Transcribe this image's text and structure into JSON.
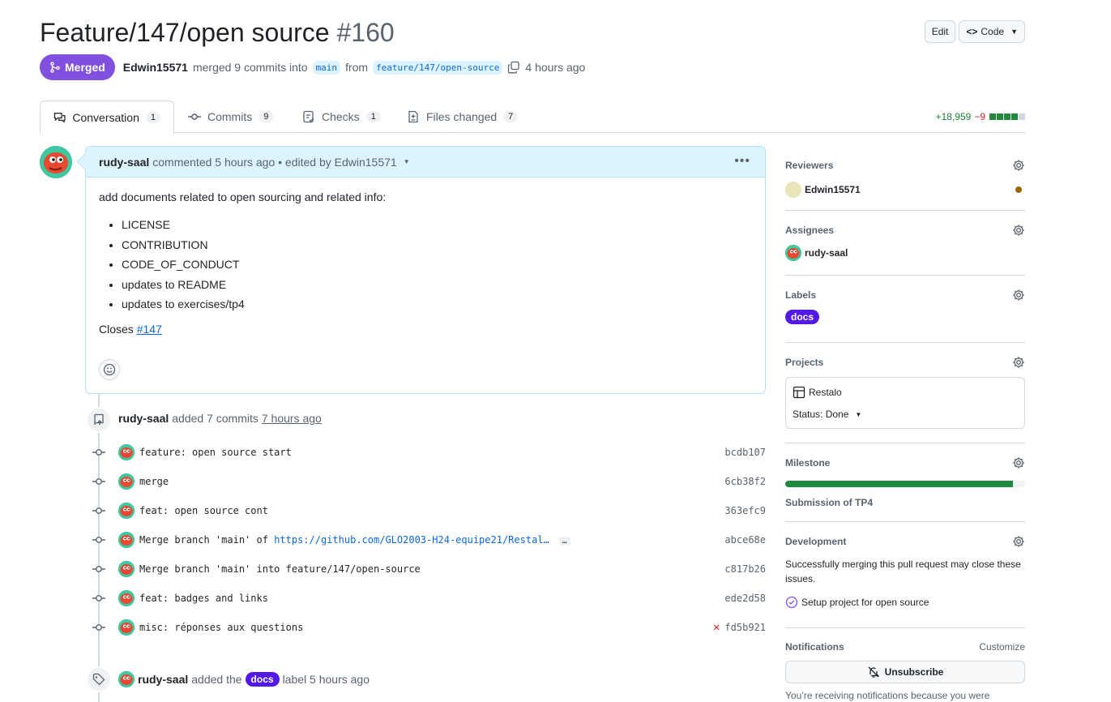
{
  "pr": {
    "title": "Feature/147/open source",
    "number": "#160",
    "state": "Merged",
    "author": "Edwin15571",
    "merged_text": "merged 9 commits into",
    "base_branch": "main",
    "from_text": "from",
    "head_branch": "feature/147/open-source",
    "time": "4 hours ago"
  },
  "header_buttons": {
    "edit": "Edit",
    "code": "Code"
  },
  "tabs": [
    {
      "label": "Conversation",
      "count": "1"
    },
    {
      "label": "Commits",
      "count": "9"
    },
    {
      "label": "Checks",
      "count": "1"
    },
    {
      "label": "Files changed",
      "count": "7"
    }
  ],
  "diffstat": {
    "additions": "+18,959",
    "deletions": "−9"
  },
  "comment": {
    "author": "rudy-saal",
    "header_text": "commented 5 hours ago • edited by Edwin15571",
    "intro": "add documents related to open sourcing and related info:",
    "items": [
      "LICENSE",
      "CONTRIBUTION",
      "CODE_OF_CONDUCT",
      "updates to README",
      "updates to exercises/tp4"
    ],
    "closes_prefix": "Closes",
    "closes_link": "#147"
  },
  "commits_event": {
    "author": "rudy-saal",
    "text": "added 7 commits",
    "time": "7 hours ago"
  },
  "commits": [
    {
      "message": "feature: open source start",
      "sha": "bcdb107",
      "link": "",
      "failed": false
    },
    {
      "message": "merge",
      "sha": "6cb38f2",
      "link": "",
      "failed": false
    },
    {
      "message": "feat: open source cont",
      "sha": "363efc9",
      "link": "",
      "failed": false
    },
    {
      "message": "Merge branch 'main' of",
      "sha": "abce68e",
      "link": "https://github.com/GLO2003-H24-equipe21/Restal…",
      "failed": false
    },
    {
      "message": "Merge branch 'main' into feature/147/open-source",
      "sha": "c817b26",
      "link": "",
      "failed": false
    },
    {
      "message": "feat: badges and links",
      "sha": "ede2d58",
      "link": "",
      "failed": false
    },
    {
      "message": "misc: réponses aux questions",
      "sha": "fd5b921",
      "link": "",
      "failed": true
    }
  ],
  "label_event": {
    "author": "rudy-saal",
    "added_the": "added the",
    "label": "docs",
    "suffix": "label 5 hours ago"
  },
  "sidebar": {
    "reviewers": {
      "title": "Reviewers",
      "name": "Edwin15571"
    },
    "assignees": {
      "title": "Assignees",
      "name": "rudy-saal"
    },
    "labels": {
      "title": "Labels",
      "label": "docs"
    },
    "projects": {
      "title": "Projects",
      "project": "Restalo",
      "status": "Status: Done"
    },
    "milestone": {
      "title": "Milestone",
      "name": "Submission of TP4",
      "progress": 0.95
    },
    "development": {
      "title": "Development",
      "text": "Successfully merging this pull request may close these issues.",
      "issue": "Setup project for open source"
    },
    "notifications": {
      "title": "Notifications",
      "customize": "Customize",
      "unsubscribe": "Unsubscribe",
      "footer": "You’re receiving notifications because you were"
    }
  },
  "colors": {
    "merged": "#8250df",
    "label_docs": "#5319e7",
    "accent": "#0969da",
    "success": "#1f883d",
    "danger": "#d1242f"
  }
}
